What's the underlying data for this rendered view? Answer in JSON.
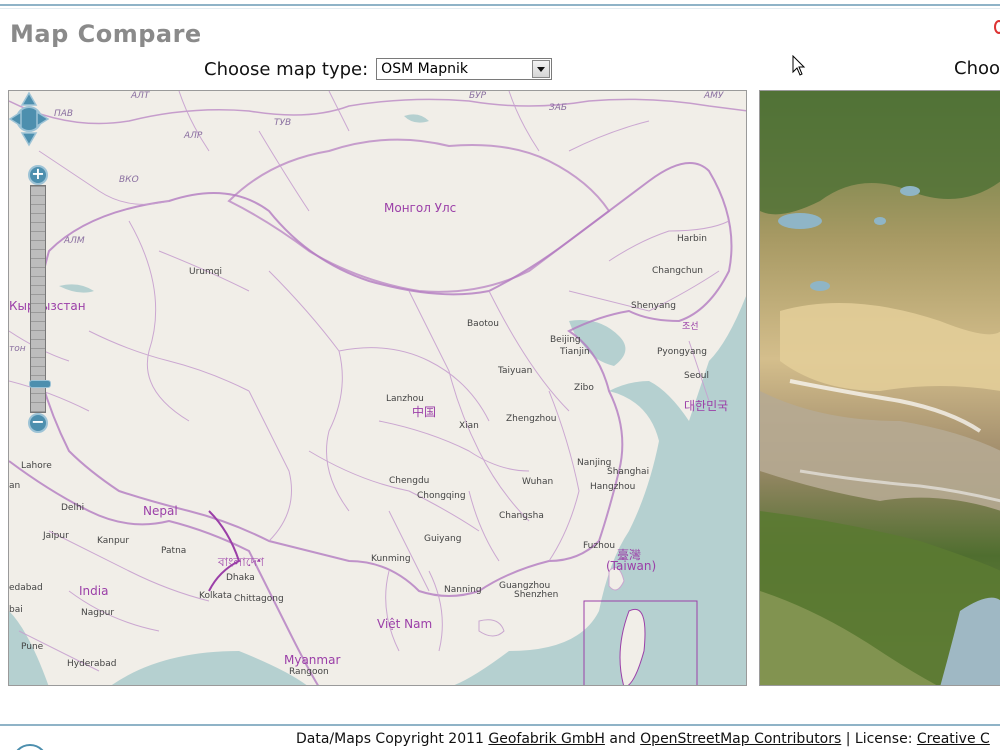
{
  "app": {
    "title": "Map Compare"
  },
  "left_panel": {
    "choose_label": "Choose map type:",
    "selected_map_type": "OSM Mapnik"
  },
  "right_panel": {
    "choose_label": "Choose map type:"
  },
  "map_labels": {
    "mongolia": "Монгол Улс",
    "kyrgyzstan": "Кыргызстан",
    "nepal": "Nepal",
    "india": "India",
    "bangladesh": "বাংলাদেশ",
    "china_native": "中国",
    "taiwan_native": "臺灣",
    "taiwan": "(Taiwan)",
    "korea_native": "대한민국",
    "pyongyang_native": "조선",
    "vietnam_native": "Việt Nam",
    "myanmar": "Myanmar",
    "urumqi": "Urumqi",
    "baotou": "Baotou",
    "beijing": "Beijing",
    "tianjin": "Tianjin",
    "taiyuan": "Taiyuan",
    "zibo": "Zibo",
    "lanzhou": "Lanzhou",
    "xian": "Xian",
    "zhengzhou": "Zhengzhou",
    "nanjing": "Nanjing",
    "shanghai": "Shanghai",
    "hangzhou": "Hangzhou",
    "wuhan": "Wuhan",
    "chengdu": "Chengdu",
    "chongqing": "Chongqing",
    "changsha": "Changsha",
    "guiyang": "Guiyang",
    "kunming": "Kunming",
    "fuzhou": "Fuzhou",
    "nanning": "Nanning",
    "guangzhou": "Guangzhou",
    "shenzhen": "Shenzhen",
    "harbin": "Harbin",
    "changchun": "Changchun",
    "shenyang": "Shenyang",
    "pyongyang": "Pyongyang",
    "seoul": "Seoul",
    "lahore": "Lahore",
    "delhi": "Delhi",
    "jaipur": "Jaipur",
    "kanpur": "Kanpur",
    "patna": "Patna",
    "dhaka": "Dhaka",
    "kolkata": "Kolkata",
    "chittagong": "Chittagong",
    "nagpur": "Nagpur",
    "pune": "Pune",
    "hyderabad": "Hyderabad",
    "ahmedabad": "edabad",
    "mumbai": "bai",
    "yangon": "Rangoon",
    "alt": "АЛТ",
    "pav": "ПАВ",
    "alr": "АЛР",
    "tuv": "ТУВ",
    "bur": "БУР",
    "zab": "ЗАБ",
    "amu": "АМУ",
    "vko": "ВКО",
    "alm": "АЛМ",
    "ton": "тон",
    "an": "an"
  },
  "footer": {
    "prefix": "Data/Maps Copyright 2011",
    "geofabrik": "Geofabrik GmbH",
    "and": "and",
    "osm": "OpenStreetMap Contributors",
    "license_prefix": "| License:",
    "license_link": "Creative C"
  },
  "colors": {
    "title": "#8a8a8a",
    "accent": "#4d8fae",
    "map_land": "#f1eee8",
    "map_water": "#b5d0d0",
    "border": "#9b3fa8"
  },
  "icons": {
    "pan": "pan-arrows-icon",
    "zoom_in": "zoom-in-icon",
    "zoom_out": "zoom-out-icon",
    "cursor": "mouse-pointer-icon"
  }
}
